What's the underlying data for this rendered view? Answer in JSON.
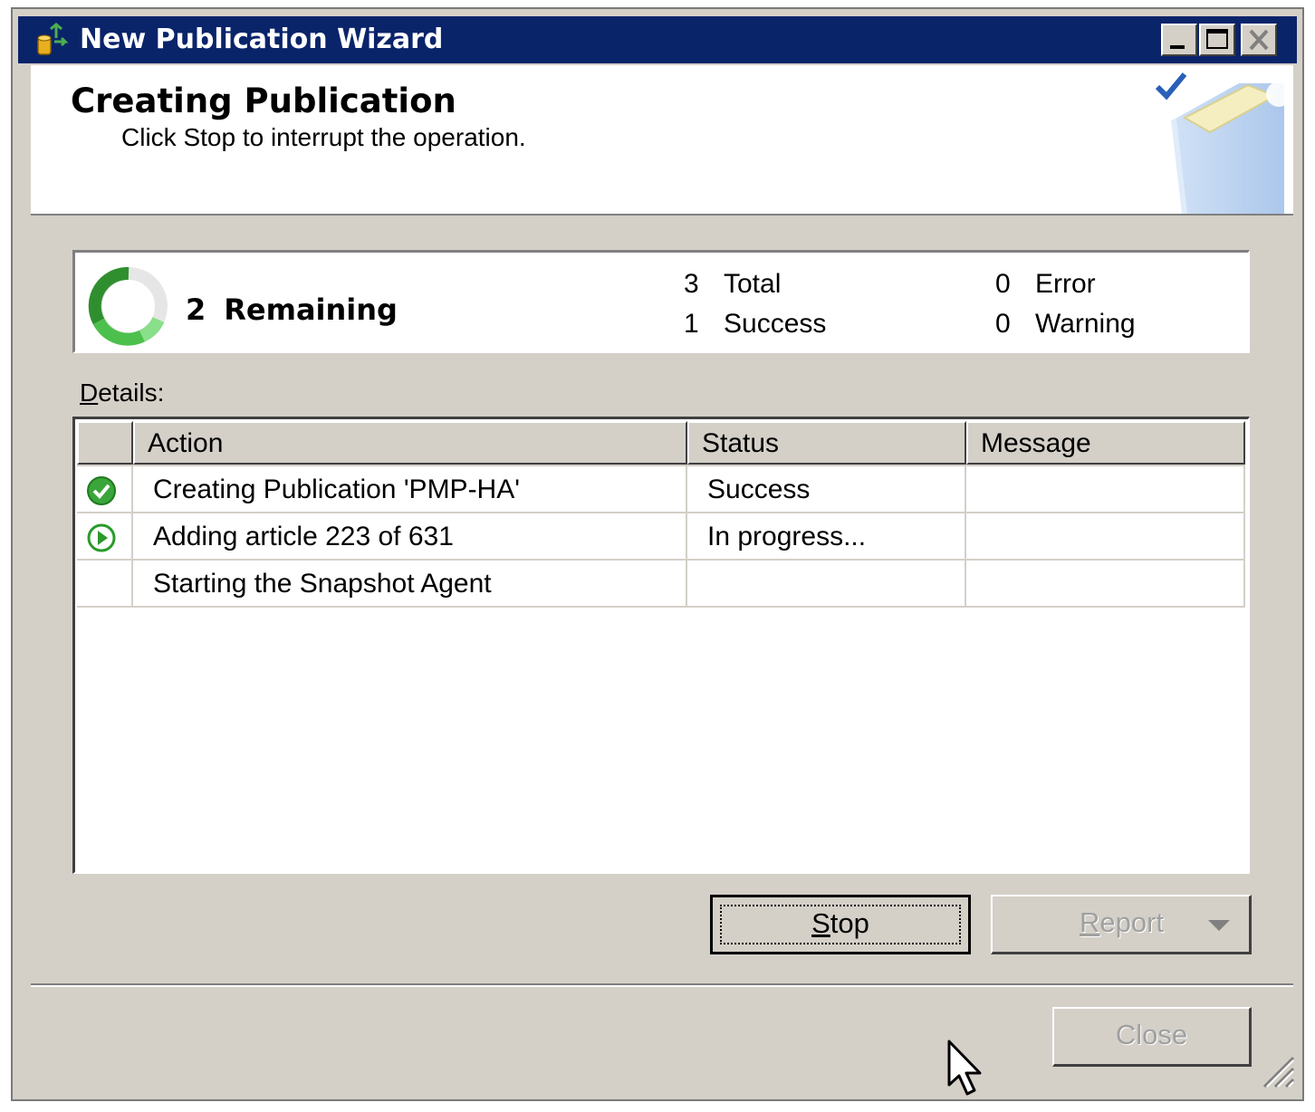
{
  "window": {
    "title": "New Publication Wizard",
    "icon": "publication-wizard-icon"
  },
  "header": {
    "title": "Creating Publication",
    "subtitle": "Click Stop to interrupt the operation."
  },
  "summary": {
    "remaining_count": "2",
    "remaining_label": "Remaining",
    "total_count": "3",
    "total_label": "Total",
    "success_count": "1",
    "success_label": "Success",
    "error_count": "0",
    "error_label": "Error",
    "warning_count": "0",
    "warning_label": "Warning"
  },
  "details": {
    "label_mnemonic": "D",
    "label_rest": "etails:",
    "columns": [
      "Action",
      "Status",
      "Message"
    ],
    "rows": [
      {
        "icon": "success-check-icon",
        "action": "Creating Publication 'PMP-HA'",
        "status": "Success",
        "message": ""
      },
      {
        "icon": "in-progress-play-icon",
        "action": "Adding article 223 of 631",
        "status": "In progress...",
        "message": ""
      },
      {
        "icon": "",
        "action": "Starting the Snapshot Agent",
        "status": "",
        "message": ""
      }
    ]
  },
  "buttons": {
    "stop_mnemonic": "S",
    "stop_rest": "top",
    "report_mnemonic": "R",
    "report_rest": "eport",
    "close": "Close"
  },
  "colors": {
    "titlebar": "#0a246a",
    "dialog_face": "#d4d0c8",
    "success_green": "#3aa53a"
  }
}
